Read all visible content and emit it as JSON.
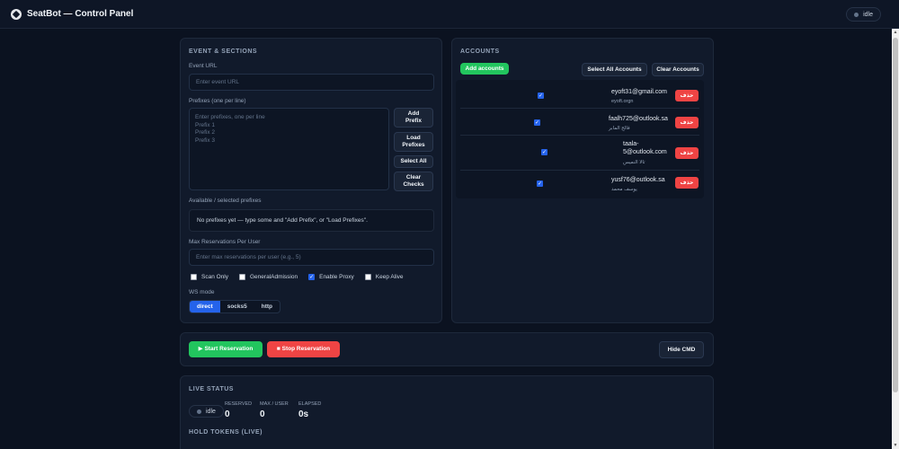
{
  "app": {
    "title": "SeatBot — Control Panel",
    "status": "idle"
  },
  "event": {
    "section_title": "EVENT & SECTIONS",
    "url_label": "Event URL",
    "url_placeholder": "Enter event URL",
    "prefixes_label": "Prefixes (one per line)",
    "prefixes_placeholder": [
      "Enter prefixes, one per line",
      "Prefix 1",
      "Prefix 2",
      "Prefix 3"
    ],
    "add_prefix": "Add Prefix",
    "load_prefixes": "Load Prefixes",
    "select_all": "Select All",
    "clear_checks": "Clear Checks",
    "available_label": "Available / selected prefixes",
    "empty_text": "No prefixes yet — type some and \"Add Prefix\", or \"Load Prefixes\".",
    "max_label": "Max Reservations Per User",
    "max_placeholder": "Enter max reservations per user (e.g., 5)",
    "options": [
      {
        "label": "Scan Only",
        "checked": false
      },
      {
        "label": "GeneralAdmission",
        "checked": false
      },
      {
        "label": "Enable Proxy",
        "checked": true
      },
      {
        "label": "Keep Alive",
        "checked": false
      }
    ],
    "ws_label": "WS mode",
    "ws_modes": [
      "direct",
      "socks5",
      "http"
    ],
    "ws_selected": "direct"
  },
  "accounts": {
    "section_title": "ACCOUNTS",
    "add_accounts": "Add accounts",
    "select_all": "Select All Accounts",
    "clear": "Clear Accounts",
    "delete_label": "حذف",
    "items": [
      {
        "email": "eyoft31@gmail.com",
        "name": "eyoft.orgn",
        "checked": true
      },
      {
        "email": "faalh725@outlook.sa",
        "name": "فالح المابر",
        "checked": true
      },
      {
        "email": "taala-\n5@outlook.com",
        "name": "تالا النميس",
        "checked": true
      },
      {
        "email": "yusf76@outlook.sa",
        "name": "يوسف محمد",
        "checked": true
      }
    ]
  },
  "actions": {
    "start": "▶ Start Reservation",
    "stop": "■ Stop Reservation",
    "hide_cmd": "Hide CMD"
  },
  "live": {
    "section_title": "LIVE STATUS",
    "status": "idle",
    "stats": [
      {
        "label": "RESERVED",
        "value": "0"
      },
      {
        "label": "MAX / USER",
        "value": "0"
      },
      {
        "label": "ELAPSED",
        "value": "0s"
      }
    ],
    "hold_title": "HOLD TOKENS (LIVE)"
  }
}
